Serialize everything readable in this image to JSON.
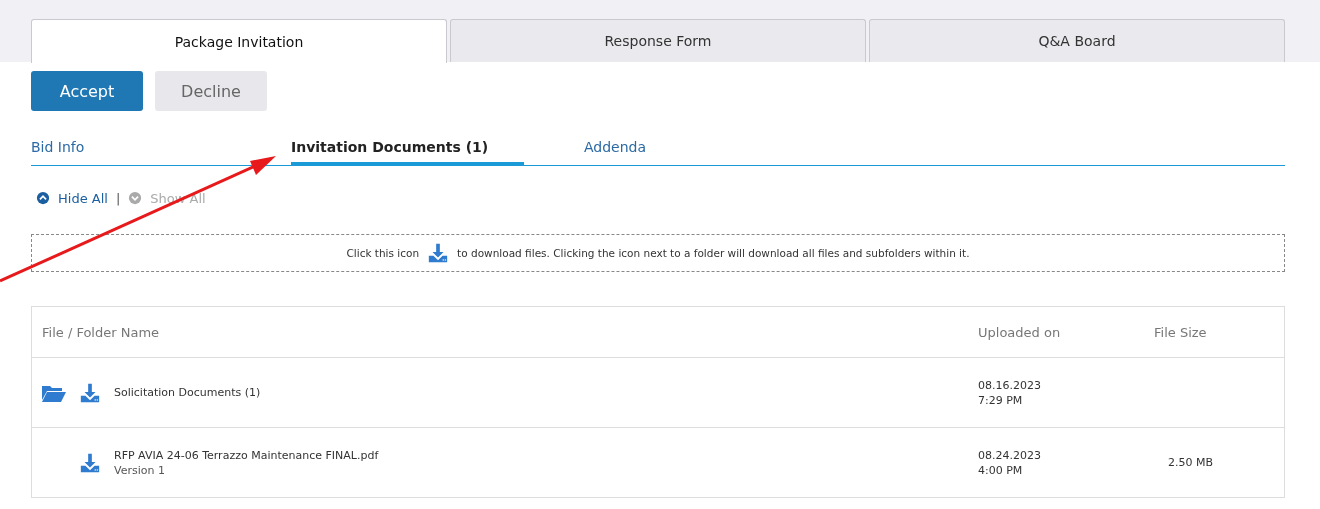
{
  "tabs": [
    {
      "label": "Package Invitation",
      "selected": true
    },
    {
      "label": "Response Form",
      "selected": false
    },
    {
      "label": "Q&A Board",
      "selected": false
    }
  ],
  "actions": [
    {
      "label": "Accept",
      "kind": "primary"
    },
    {
      "label": "Decline",
      "kind": "secondary"
    }
  ],
  "subtabs": [
    {
      "label": "Bid Info",
      "selected": false
    },
    {
      "label": "Invitation Documents (1)",
      "selected": true
    },
    {
      "label": "Addenda",
      "selected": false
    }
  ],
  "toggles": [
    {
      "label": "Hide All",
      "disabled": false
    },
    {
      "label": "Show All",
      "disabled": true
    }
  ],
  "toggle_separator": "|",
  "hint": {
    "before": "Click this icon",
    "after": "to download files. Clicking the icon next to a folder will download all files and subfolders within it."
  },
  "table": {
    "columns": [
      "File / Folder Name",
      "Uploaded on",
      "File Size"
    ],
    "rows": [
      {
        "kind": "folder",
        "name": "Solicitation Documents (1)",
        "date": "08.16.2023",
        "time": "7:29 PM"
      },
      {
        "kind": "file",
        "name": "RFP AVIA 24-06 Terrazzo Maintenance FINAL.pdf",
        "version": "Version 1",
        "date": "08.24.2023",
        "time": "4:00 PM",
        "size": "2.50 MB"
      }
    ]
  }
}
